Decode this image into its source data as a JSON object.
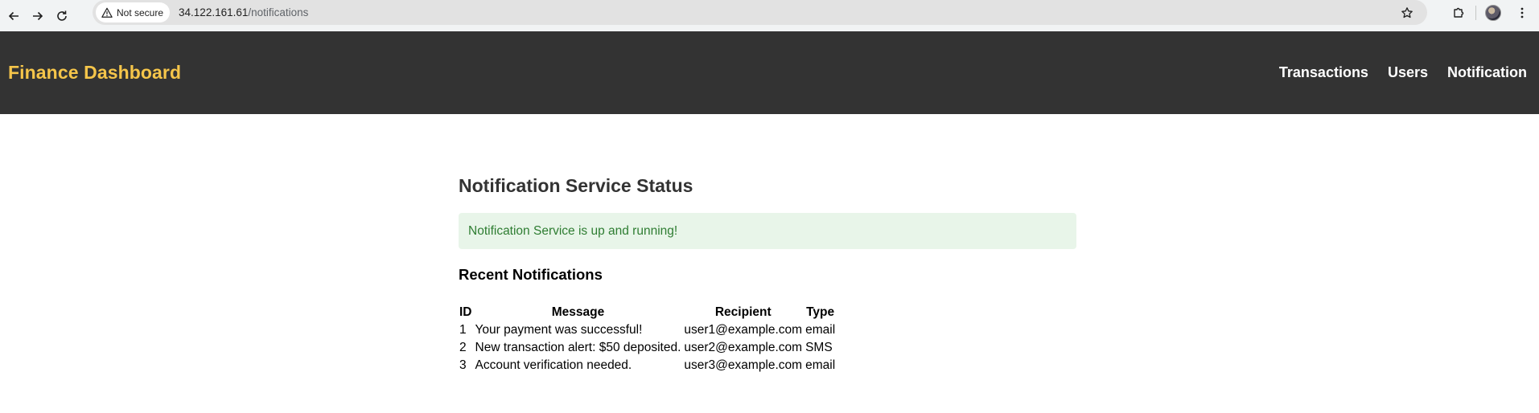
{
  "browser": {
    "security_label": "Not secure",
    "url_host": "34.122.161.61",
    "url_path": "/notifications"
  },
  "navbar": {
    "brand": "Finance Dashboard",
    "links": [
      {
        "label": "Transactions"
      },
      {
        "label": "Users"
      },
      {
        "label": "Notification"
      }
    ]
  },
  "main": {
    "title": "Notification Service Status",
    "status_message": "Notification Service is up and running!",
    "status_color": "#2e7d32",
    "status_bg": "#e8f5e9",
    "section_title": "Recent Notifications",
    "table": {
      "headers": {
        "id": "ID",
        "message": "Message",
        "recipient": "Recipient",
        "type": "Type"
      },
      "rows": [
        {
          "id": "1",
          "message": "Your payment was successful!",
          "recipient": "user1@example.com",
          "type": "email"
        },
        {
          "id": "2",
          "message": "New transaction alert: $50 deposited.",
          "recipient": "user2@example.com",
          "type": "SMS"
        },
        {
          "id": "3",
          "message": "Account verification needed.",
          "recipient": "user3@example.com",
          "type": "email"
        }
      ]
    }
  },
  "colors": {
    "navbar_bg": "#333333",
    "brand": "#f5c54a"
  }
}
